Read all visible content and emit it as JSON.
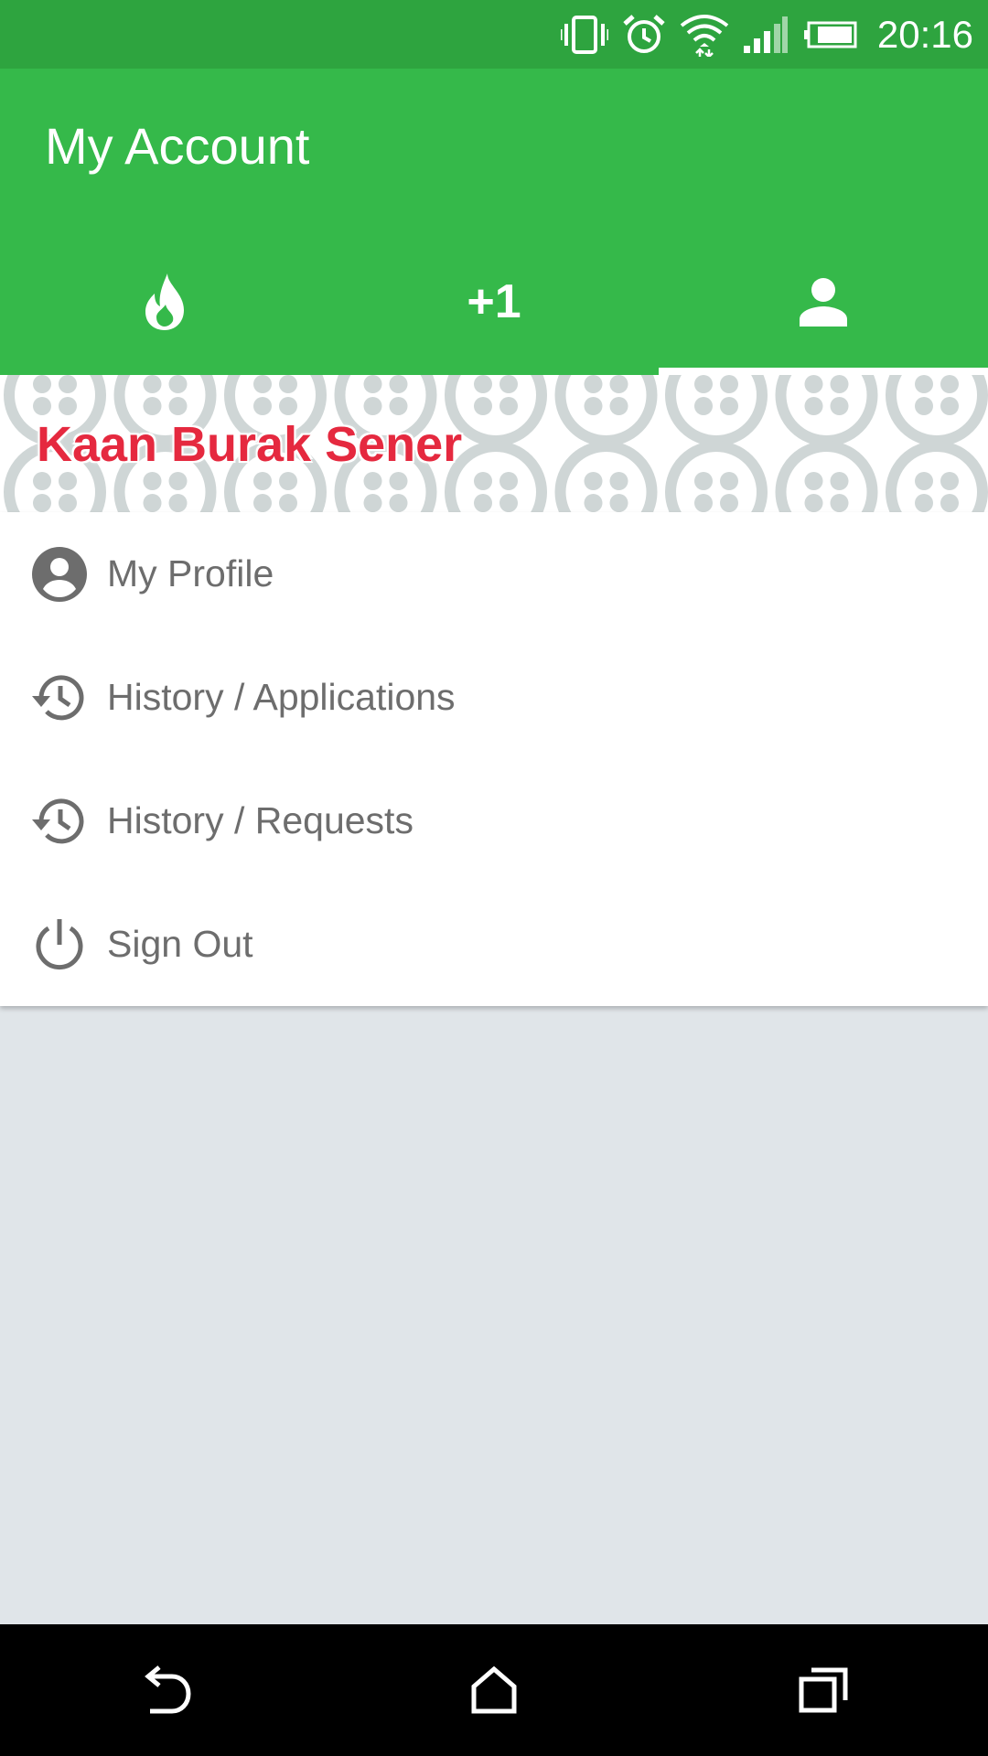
{
  "status_bar": {
    "time": "20:16",
    "icons": [
      "vibrate-icon",
      "alarm-icon",
      "wifi-icon",
      "signal-icon",
      "battery-icon"
    ]
  },
  "app_bar": {
    "title": "My Account",
    "background_color": "#35b94a",
    "status_color": "#2ea43f"
  },
  "tabs": [
    {
      "icon": "flame-icon",
      "label": "",
      "selected": false
    },
    {
      "icon": "",
      "label": "+1",
      "selected": false
    },
    {
      "icon": "person-icon",
      "label": "",
      "selected": true
    }
  ],
  "banner": {
    "user_name": "Kaan Burak Sener",
    "name_color": "#e5293f"
  },
  "menu": {
    "items": [
      {
        "label": "My Profile",
        "icon": "account-circle-icon"
      },
      {
        "label": "History / Applications",
        "icon": "history-icon"
      },
      {
        "label": "History / Requests",
        "icon": "history-icon"
      },
      {
        "label": "Sign Out",
        "icon": "power-icon"
      }
    ]
  },
  "nav_bar": {
    "icons": [
      "back-icon",
      "home-icon",
      "recents-icon"
    ]
  }
}
